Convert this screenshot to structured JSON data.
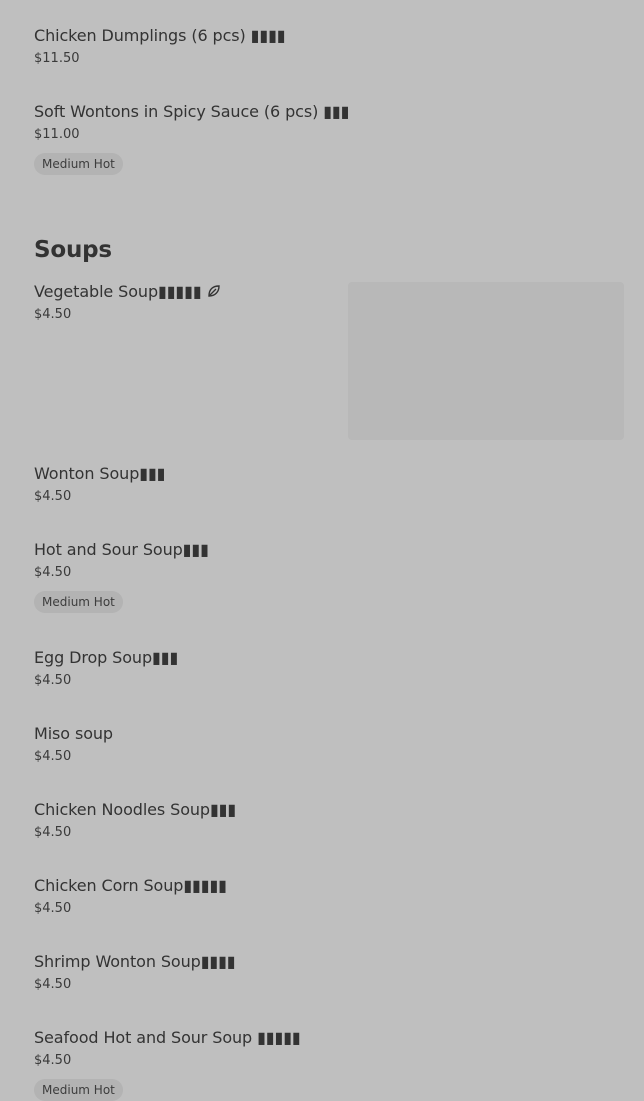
{
  "items_top": [
    {
      "name": "Chicken Dumplings (6 pcs) ▮▮▮▮",
      "price": "$11.50"
    },
    {
      "name": "Soft Wontons in Spicy Sauce (6 pcs) ▮▮▮",
      "price": "$11.00",
      "badge": "Medium Hot"
    }
  ],
  "section": {
    "title": "Soups"
  },
  "soups": [
    {
      "name": "Vegetable Soup▮▮▮▮▮",
      "price": "$4.50",
      "icon": "leaf-icon"
    },
    {
      "name": "Wonton Soup▮▮▮",
      "price": "$4.50"
    },
    {
      "name": "Hot and Sour Soup▮▮▮",
      "price": "$4.50",
      "badge": "Medium Hot"
    },
    {
      "name": "Egg Drop Soup▮▮▮",
      "price": "$4.50"
    },
    {
      "name": "Miso soup",
      "price": "$4.50"
    },
    {
      "name": "Chicken Noodles Soup▮▮▮",
      "price": "$4.50"
    },
    {
      "name": "Chicken Corn Soup▮▮▮▮▮",
      "price": "$4.50"
    },
    {
      "name": "Shrimp Wonton Soup▮▮▮▮",
      "price": "$4.50"
    },
    {
      "name": "Seafood Hot and Sour Soup ▮▮▮▮▮",
      "price": "$4.50",
      "badge": "Medium Hot"
    }
  ]
}
